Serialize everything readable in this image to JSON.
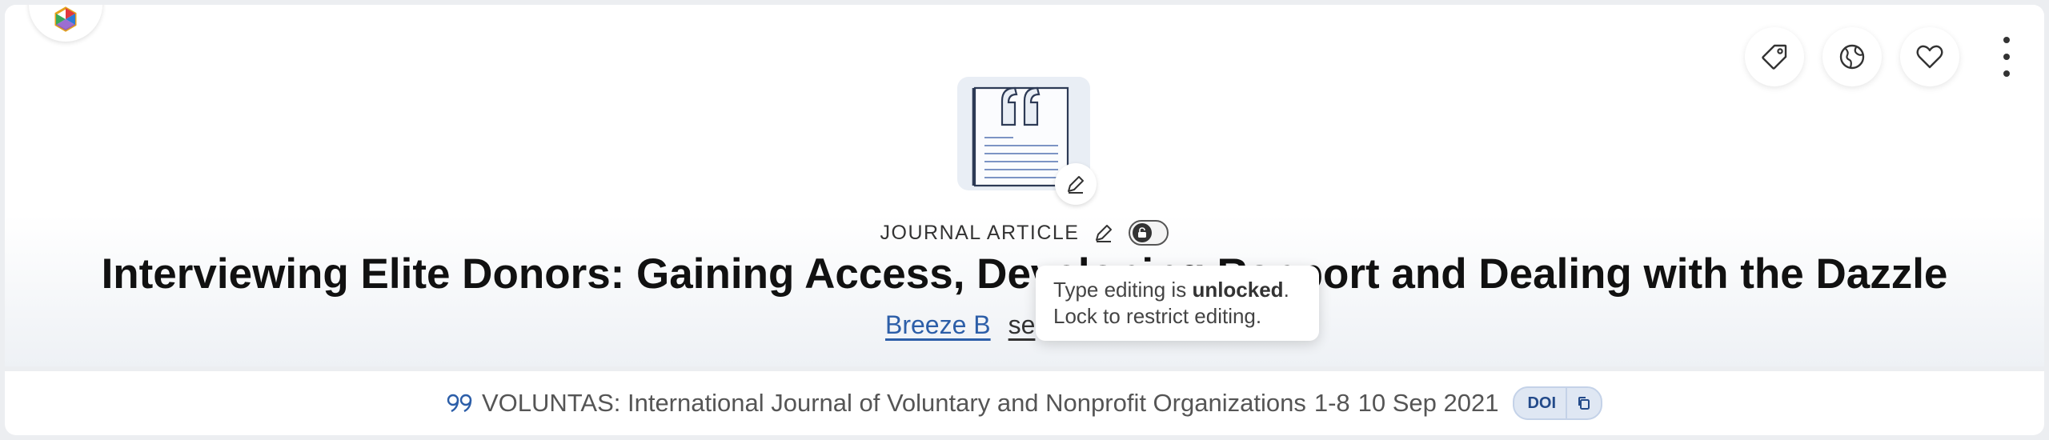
{
  "header": {
    "item_type": "JOURNAL ARTICLE",
    "title": "Interviewing Elite Donors: Gaining Access, Developing Rapport and Dealing with the Dazzle",
    "authors": [
      {
        "name": "Breeze B"
      },
      {
        "name": "se"
      }
    ]
  },
  "tooltip": {
    "prefix": "Type editing is ",
    "state": "unlocked",
    "suffix": ".",
    "line2": "Lock to restrict editing."
  },
  "citation": {
    "journal": "VOLUNTAS: International Journal of Voluntary and Nonprofit Organizations",
    "pages": "1-8",
    "date": "10 Sep 2021",
    "doi_label": "DOI"
  },
  "actions": {
    "icons": [
      "tag-icon",
      "globe-icon",
      "heart-icon",
      "more-vertical-icon"
    ]
  },
  "colors": {
    "link": "#2c5ea8",
    "doi_pill": "#dfe7f3",
    "thumbnail_bg": "#e9eef5"
  }
}
